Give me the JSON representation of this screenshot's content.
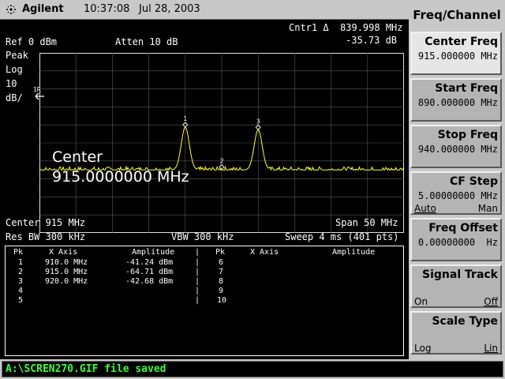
{
  "titlebar": {
    "brand": "Agilent",
    "time": "10:37:08",
    "date": "Jul 28, 2003"
  },
  "header": {
    "marker_readout": "Cntr1 Δ  839.998 MHz",
    "marker_delta": "-35.73 dB",
    "ref_level": "Ref 0 dBm",
    "atten": "Atten 10 dB",
    "detector": "Peak",
    "scale_mode": "Log",
    "scale_div": "10",
    "scale_unit": "dB/",
    "ref_marker_label": "1R"
  },
  "overlay": {
    "center_label": "Center",
    "center_value": "915.0000000 MHz"
  },
  "footer": {
    "center": "Center 915 MHz",
    "span": "Span 50 MHz",
    "rbw": "Res BW 300 kHz",
    "vbw": "VBW 300 kHz",
    "sweep": "Sweep 4 ms (401 pts)"
  },
  "marker_table": {
    "headers": [
      "Pk",
      "X Axis",
      "Amplitude",
      "Pk",
      "X Axis",
      "Amplitude"
    ],
    "rows": [
      {
        "pk": "1",
        "x": "910.0 MHz",
        "amp": "-41.24 dBm",
        "pk2": "6"
      },
      {
        "pk": "2",
        "x": "915.0 MHz",
        "amp": "-64.71 dBm",
        "pk2": "7"
      },
      {
        "pk": "3",
        "x": "920.0 MHz",
        "amp": "-42.68 dBm",
        "pk2": "8"
      },
      {
        "pk": "4",
        "x": "",
        "amp": "",
        "pk2": "9"
      },
      {
        "pk": "5",
        "x": "",
        "amp": "",
        "pk2": "10"
      }
    ]
  },
  "chart_data": {
    "type": "line",
    "x_unit": "MHz",
    "xlim": [
      890,
      940
    ],
    "ylim": [
      -100,
      0
    ],
    "y_unit": "dBm",
    "grid": true,
    "trace_color": "#ffff33",
    "noise_floor_dbm": -65,
    "peaks": [
      {
        "label": "1",
        "x": 910.0,
        "y": -41.24
      },
      {
        "label": "2",
        "x": 915.0,
        "y": -64.71
      },
      {
        "label": "3",
        "x": 920.0,
        "y": -42.68
      }
    ]
  },
  "softkeys": {
    "title": "Freq/Channel",
    "center_freq": {
      "label": "Center Freq",
      "value": "915.000000 MHz"
    },
    "start_freq": {
      "label": "Start Freq",
      "value": "890.000000 MHz"
    },
    "stop_freq": {
      "label": "Stop Freq",
      "value": "940.000000 MHz"
    },
    "cf_step": {
      "label": "CF Step",
      "value": "5.00000000 MHz",
      "opt_left": "Auto",
      "opt_right": "Man"
    },
    "freq_offset": {
      "label": "Freq Offset",
      "value": "0.00000000  Hz"
    },
    "signal_track": {
      "label": "Signal Track",
      "opt_left": "On",
      "opt_right": "Off"
    },
    "scale_type": {
      "label": "Scale Type",
      "opt_left": "Log",
      "opt_right": "Lin"
    }
  },
  "status": {
    "message": "A:\\SCREN270.GIF file saved"
  }
}
